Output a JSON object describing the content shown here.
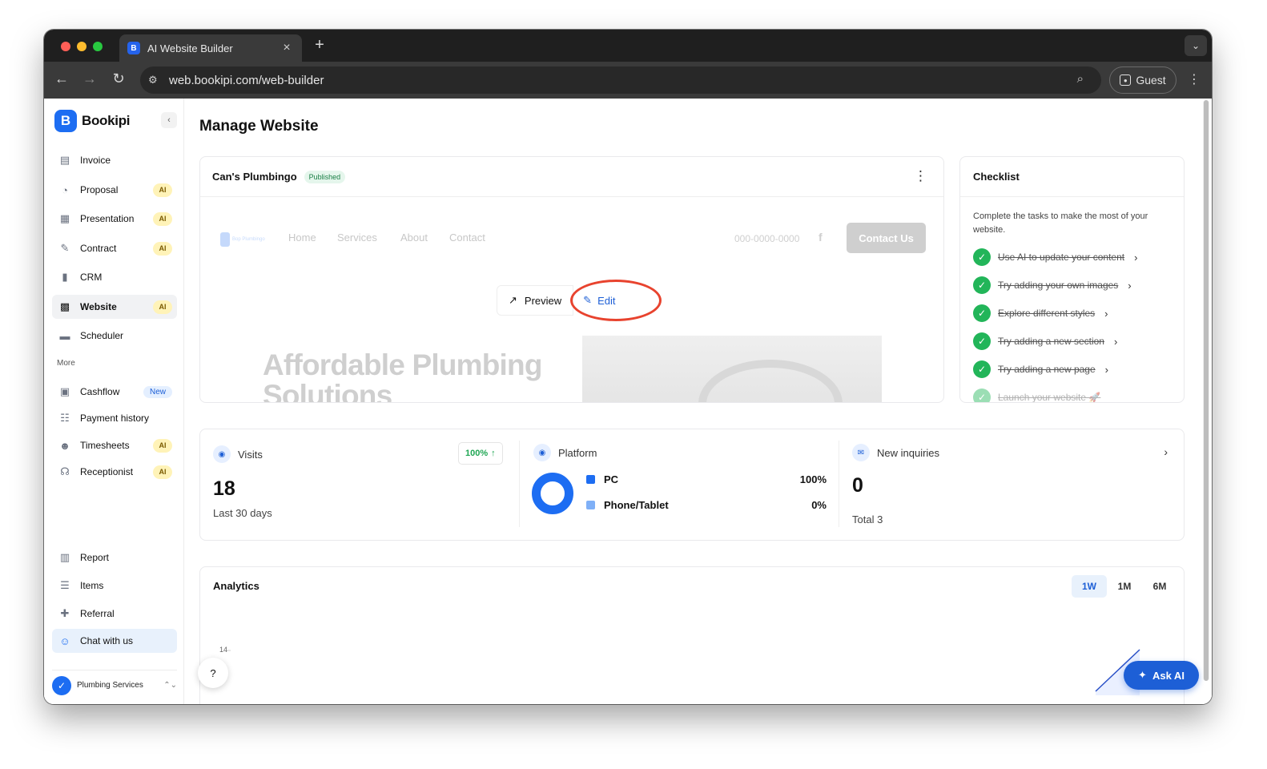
{
  "browser": {
    "tab_title": "AI Website Builder",
    "tab_close": "×",
    "new_tab": "+",
    "url": "web.bookipi.com/web-builder",
    "profile_label": "Guest"
  },
  "sidebar": {
    "brand": "Bookipi",
    "collapse": "‹",
    "items": [
      {
        "label": "Invoice",
        "icon": "invoice-icon",
        "glyph": "▤",
        "badge": ""
      },
      {
        "label": "Proposal",
        "icon": "proposal-icon",
        "glyph": "◔",
        "badge": "AI"
      },
      {
        "label": "Presentation",
        "icon": "presentation-icon",
        "glyph": "▦",
        "badge": "AI"
      },
      {
        "label": "Contract",
        "icon": "contract-icon",
        "glyph": "✎",
        "badge": "AI"
      },
      {
        "label": "CRM",
        "icon": "crm-icon",
        "glyph": "▮",
        "badge": ""
      },
      {
        "label": "Website",
        "icon": "website-icon",
        "glyph": "▩",
        "badge": "AI"
      },
      {
        "label": "Scheduler",
        "icon": "scheduler-icon",
        "glyph": "▬",
        "badge": ""
      }
    ],
    "more_label": "More",
    "more_items": [
      {
        "label": "Cashflow",
        "icon": "cashflow-icon",
        "glyph": "▣",
        "badge": "New"
      },
      {
        "label": "Payment history",
        "icon": "payment-history-icon",
        "glyph": "☷",
        "badge": ""
      },
      {
        "label": "Timesheets",
        "icon": "timesheets-icon",
        "glyph": "☻",
        "badge": "AI"
      },
      {
        "label": "Receptionist",
        "icon": "receptionist-icon",
        "glyph": "☊",
        "badge": "AI"
      }
    ],
    "bottom_items": [
      {
        "label": "Report",
        "icon": "report-icon",
        "glyph": "▥"
      },
      {
        "label": "Items",
        "icon": "items-icon",
        "glyph": "☰"
      },
      {
        "label": "Referral",
        "icon": "referral-icon",
        "glyph": "✚"
      },
      {
        "label": "Chat with us",
        "icon": "chat-icon",
        "glyph": "☺"
      }
    ],
    "account_name": "Plumbing Services",
    "account_chevron": "⌃⌄"
  },
  "main": {
    "title": "Manage Website",
    "site": {
      "name": "Can's Plumbingo",
      "status": "Published",
      "preview": {
        "logo_text": "Bop Plumbingo",
        "nav": [
          "Home",
          "Services",
          "About",
          "Contact"
        ],
        "phone": "000-0000-0000",
        "fb": "f",
        "contact_button": "Contact Us",
        "hero_line1": "Affordable Plumbing",
        "hero_line2": "Solutions"
      },
      "preview_button": "Preview",
      "edit_button": "Edit"
    },
    "checklist": {
      "title": "Checklist",
      "description": "Complete the tasks to make the most of your website.",
      "items": [
        "Use AI to update your content",
        "Try adding your own images",
        "Explore different styles",
        "Try adding a new section",
        "Try adding a new page",
        "Launch your website 🚀"
      ]
    },
    "stats": {
      "visits": {
        "title": "Visits",
        "value": "18",
        "sub": "Last 30 days",
        "growth": "100%"
      },
      "platform": {
        "title": "Platform",
        "rows": [
          {
            "label": "PC",
            "value": "100%",
            "color": "#1d6df2"
          },
          {
            "label": "Phone/Tablet",
            "value": "0%",
            "color": "#7fb0f7"
          }
        ]
      },
      "inquiries": {
        "title": "New inquiries",
        "value": "0",
        "sub": "Total 3"
      }
    },
    "analytics": {
      "title": "Analytics",
      "ranges": [
        "1W",
        "1M",
        "6M"
      ],
      "active_range": "1W",
      "y_tick": "14"
    },
    "ask_ai": "Ask AI"
  },
  "colors": {
    "brand": "#1d6df2",
    "success": "#22b559",
    "highlight_ring": "#e8432e"
  }
}
